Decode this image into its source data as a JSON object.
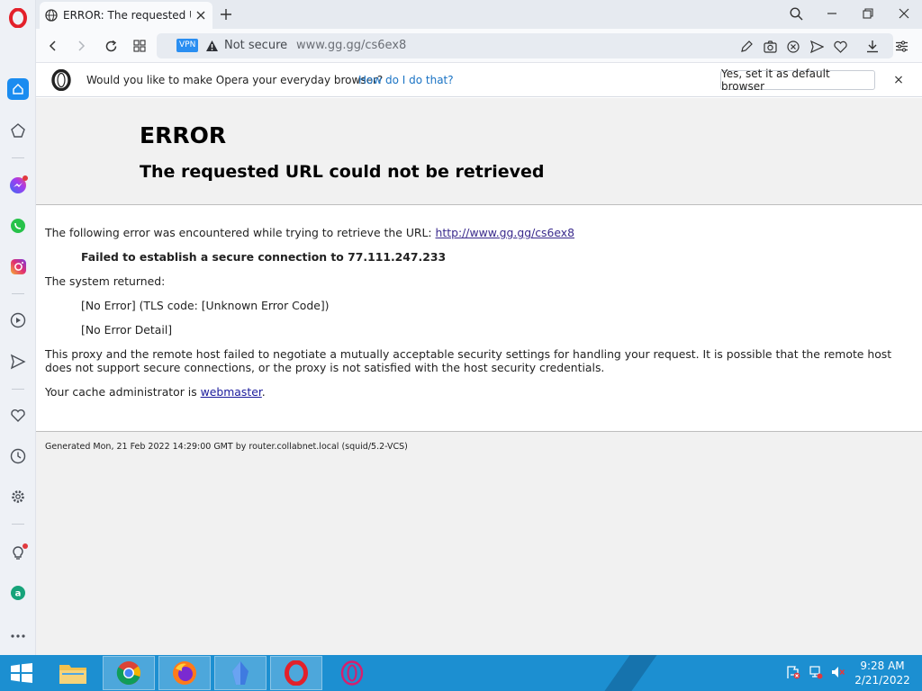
{
  "browser": {
    "tab_title": "ERROR: The requested URL",
    "security_label": "Not secure",
    "vpn_label": "VPN",
    "url": "www.gg.gg/cs6ex8"
  },
  "banner": {
    "question": "Would you like to make Opera your everyday browser?",
    "link": "How do I do that?",
    "button": "Yes, set it as default browser",
    "close": "×"
  },
  "page": {
    "title": "ERROR",
    "subtitle": "The requested URL could not be retrieved",
    "line1_prefix": "The following error was encountered while trying to retrieve the URL: ",
    "line1_link": "http://www.gg.gg/cs6ex8",
    "failed": "Failed to establish a secure connection to 77.111.247.233",
    "system_returned": "The system returned:",
    "no_error": "[No Error] (TLS code: [Unknown Error Code])",
    "no_error_detail": "[No Error Detail]",
    "paragraph": "This proxy and the remote host failed to negotiate a mutually acceptable security settings for handling your request. It is possible that the remote host does not support secure connections, or the proxy is not satisfied with the host security credentials.",
    "admin_prefix": "Your cache administrator is ",
    "admin_link": "webmaster",
    "admin_suffix": ".",
    "footer": "Generated Mon, 21 Feb 2022 14:29:00 GMT by router.collabnet.local (squid/5.2-VCS)"
  },
  "taskbar": {
    "time": "9:28 AM",
    "date": "2/21/2022",
    "items": [
      "start",
      "file-explorer",
      "chrome",
      "firefox",
      "app",
      "opera",
      "opera-gx"
    ]
  },
  "colors": {
    "accent": "#1c8fd1",
    "opera_red": "#e3202a",
    "link": "#1a73c4"
  }
}
